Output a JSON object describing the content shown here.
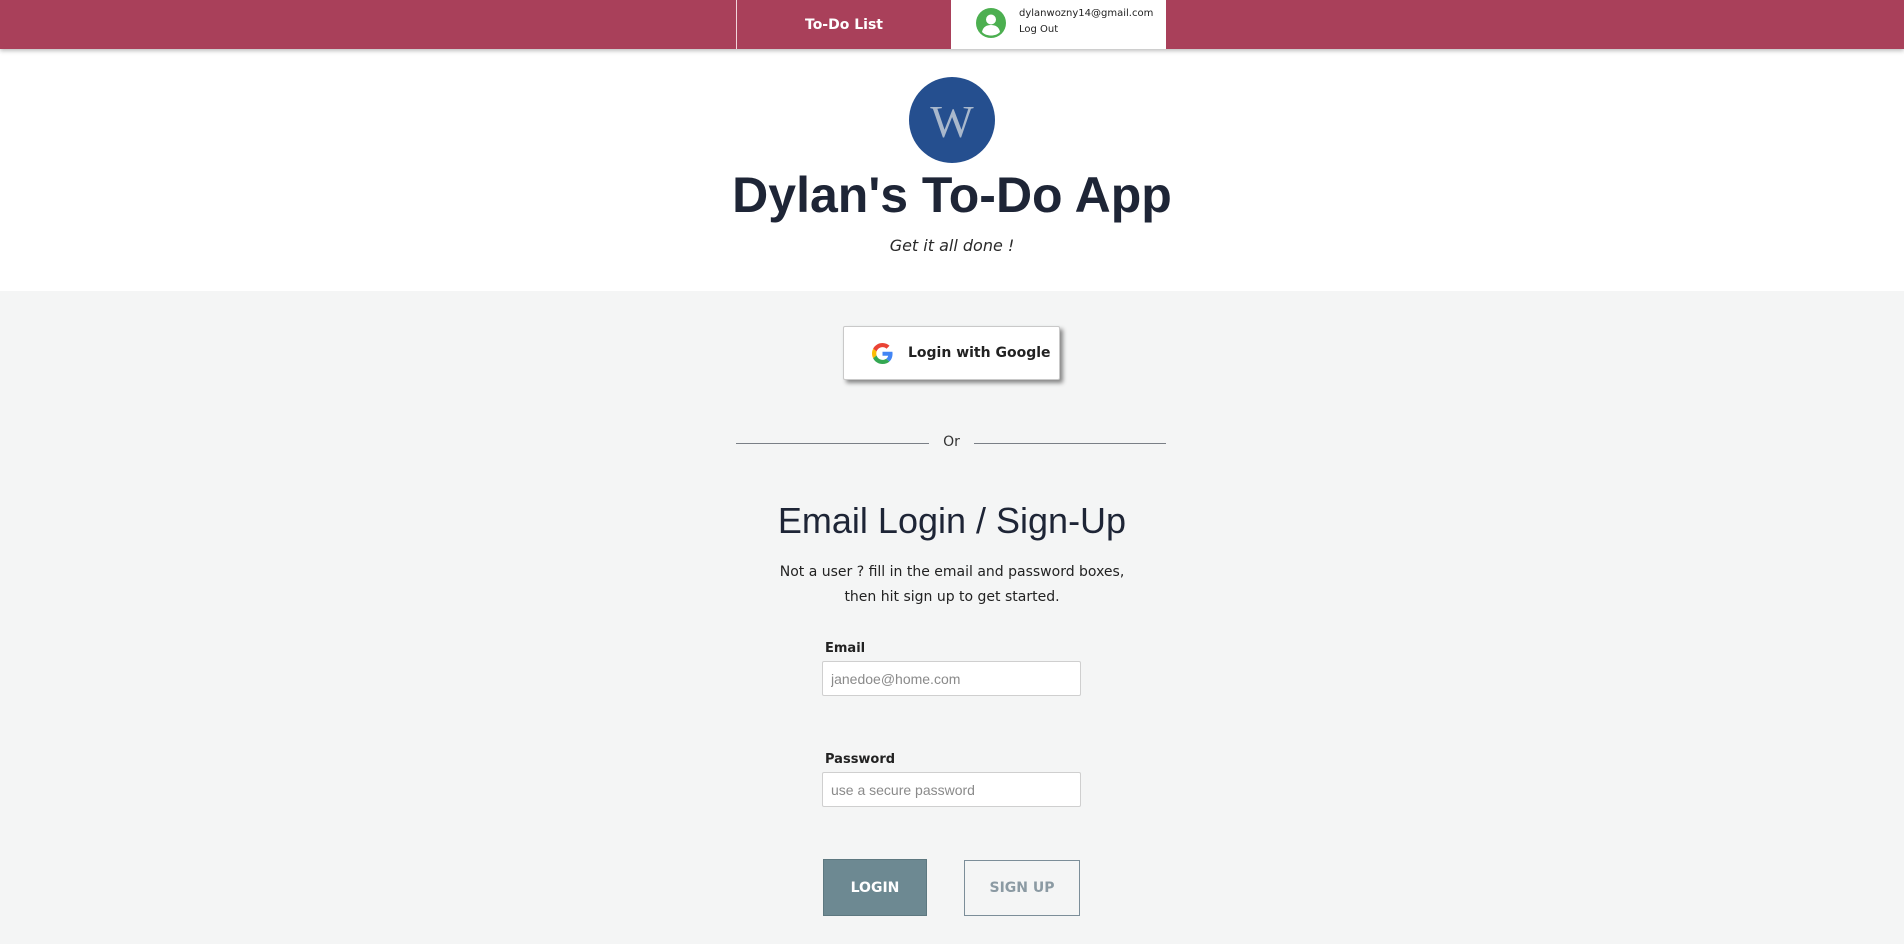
{
  "colors": {
    "brand": "#a9405a",
    "title": "#1e2536",
    "logo_bg": "#254f8f",
    "login_button": "#6d8992",
    "avatar": "#4caf50"
  },
  "nav": {
    "tab_label": "To-Do List",
    "user_email": "dylanwozny14@gmail.com",
    "logout_label": "Log Out",
    "avatar_icon": "account-circle-icon"
  },
  "header": {
    "logo_icon": "w-logo-icon",
    "logo_letter": "W",
    "title": "Dylan's To-Do App",
    "subtitle": "Get it all done !"
  },
  "google": {
    "icon": "google-g-icon",
    "label": "Login with Google"
  },
  "divider": {
    "text": "Or"
  },
  "email_login": {
    "title": "Email Login / Sign-Up",
    "desc_line1": "Not a user ? fill in the email and password boxes,",
    "desc_line2": "then hit sign up to get started.",
    "email_label": "Email",
    "email_placeholder": "janedoe@home.com",
    "email_value": "",
    "password_label": "Password",
    "password_placeholder": "use a secure password",
    "password_value": "",
    "login_label": "LOGIN",
    "signup_label": "SIGN UP"
  }
}
